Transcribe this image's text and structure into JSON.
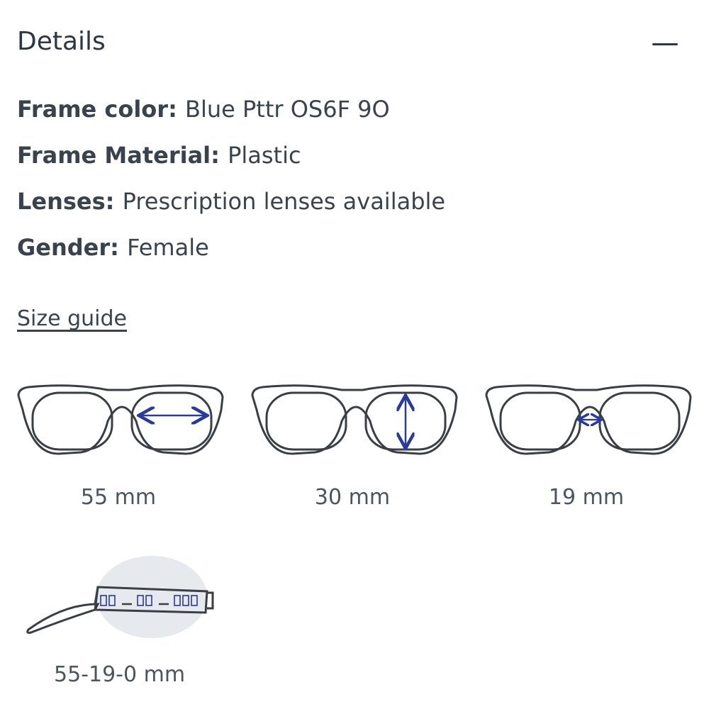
{
  "header": {
    "title": "Details",
    "collapse_icon": "minus-icon"
  },
  "details": [
    {
      "key": "Frame color",
      "value": "Blue Pttr OS6F 9O"
    },
    {
      "key": "Frame Material",
      "value": "Plastic"
    },
    {
      "key": "Lenses",
      "value": "Prescription lenses available"
    },
    {
      "key": "Gender",
      "value": "Female"
    }
  ],
  "size_guide": {
    "label": "Size guide"
  },
  "measurements": [
    {
      "label": "55 mm",
      "icon": "lens-width-icon"
    },
    {
      "label": "30 mm",
      "icon": "lens-height-icon"
    },
    {
      "label": "19 mm",
      "icon": "bridge-width-icon"
    }
  ],
  "temple": {
    "label": "55-19-0 mm",
    "icon": "temple-size-icon"
  },
  "colors": {
    "text": "#3a434d",
    "frame_outline": "#3a3f45",
    "arrow": "#2a3a9a",
    "highlight": "#e6e9ee"
  }
}
